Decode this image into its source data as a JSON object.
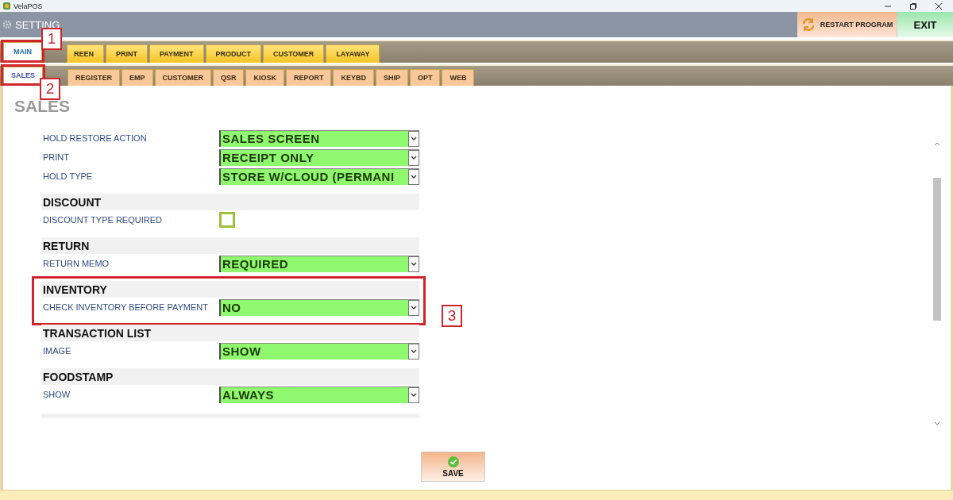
{
  "window": {
    "title": "VelaPOS"
  },
  "header": {
    "title": "SETTING",
    "restart_button": "RESTART PROGRAM",
    "exit_button": "EXIT"
  },
  "main_tabs": [
    {
      "label": "MAIN",
      "selected": true,
      "callout": "1"
    },
    {
      "label": "REEN",
      "selected": false
    },
    {
      "label": "PRINT",
      "selected": false
    },
    {
      "label": "PAYMENT",
      "selected": false
    },
    {
      "label": "PRODUCT",
      "selected": false
    },
    {
      "label": "CUSTOMER",
      "selected": false
    },
    {
      "label": "LAYAWAY",
      "selected": false
    }
  ],
  "sub_tabs": [
    {
      "label": "SALES",
      "selected": true,
      "callout": "2"
    },
    {
      "label": "REGISTER",
      "selected": false
    },
    {
      "label": "EMP",
      "selected": false
    },
    {
      "label": "CUSTOMER",
      "selected": false
    },
    {
      "label": "QSR",
      "selected": false
    },
    {
      "label": "KIOSK",
      "selected": false
    },
    {
      "label": "REPORT",
      "selected": false
    },
    {
      "label": "KEYBD",
      "selected": false
    },
    {
      "label": "SHIP",
      "selected": false
    },
    {
      "label": "OPT",
      "selected": false
    },
    {
      "label": "WEB",
      "selected": false
    }
  ],
  "page_title": "SALES",
  "sections": [
    {
      "rows": [
        {
          "kind": "select",
          "label": "HOLD RESTORE ACTION",
          "value": "SALES SCREEN"
        },
        {
          "kind": "select",
          "label": "PRINT",
          "value": "RECEIPT ONLY"
        },
        {
          "kind": "select",
          "label": "HOLD TYPE",
          "value": "STORE W/CLOUD (PERMANI"
        }
      ]
    },
    {
      "title": "DISCOUNT",
      "rows": [
        {
          "kind": "checkbox",
          "label": "DISCOUNT TYPE REQUIRED",
          "checked": false
        }
      ]
    },
    {
      "title": "RETURN",
      "rows": [
        {
          "kind": "select",
          "label": "RETURN MEMO",
          "value": "REQUIRED"
        }
      ]
    },
    {
      "title": "INVENTORY",
      "callout": "3",
      "rows": [
        {
          "kind": "select",
          "label": "CHECK INVENTORY BEFORE PAYMENT",
          "value": "NO"
        }
      ]
    },
    {
      "title": "TRANSACTION LIST",
      "rows": [
        {
          "kind": "select",
          "label": "IMAGE",
          "value": "SHOW"
        }
      ]
    },
    {
      "title": "FOODSTAMP",
      "rows": [
        {
          "kind": "select",
          "label": "SHOW",
          "value": "ALWAYS"
        }
      ]
    }
  ],
  "save_button": "SAVE"
}
